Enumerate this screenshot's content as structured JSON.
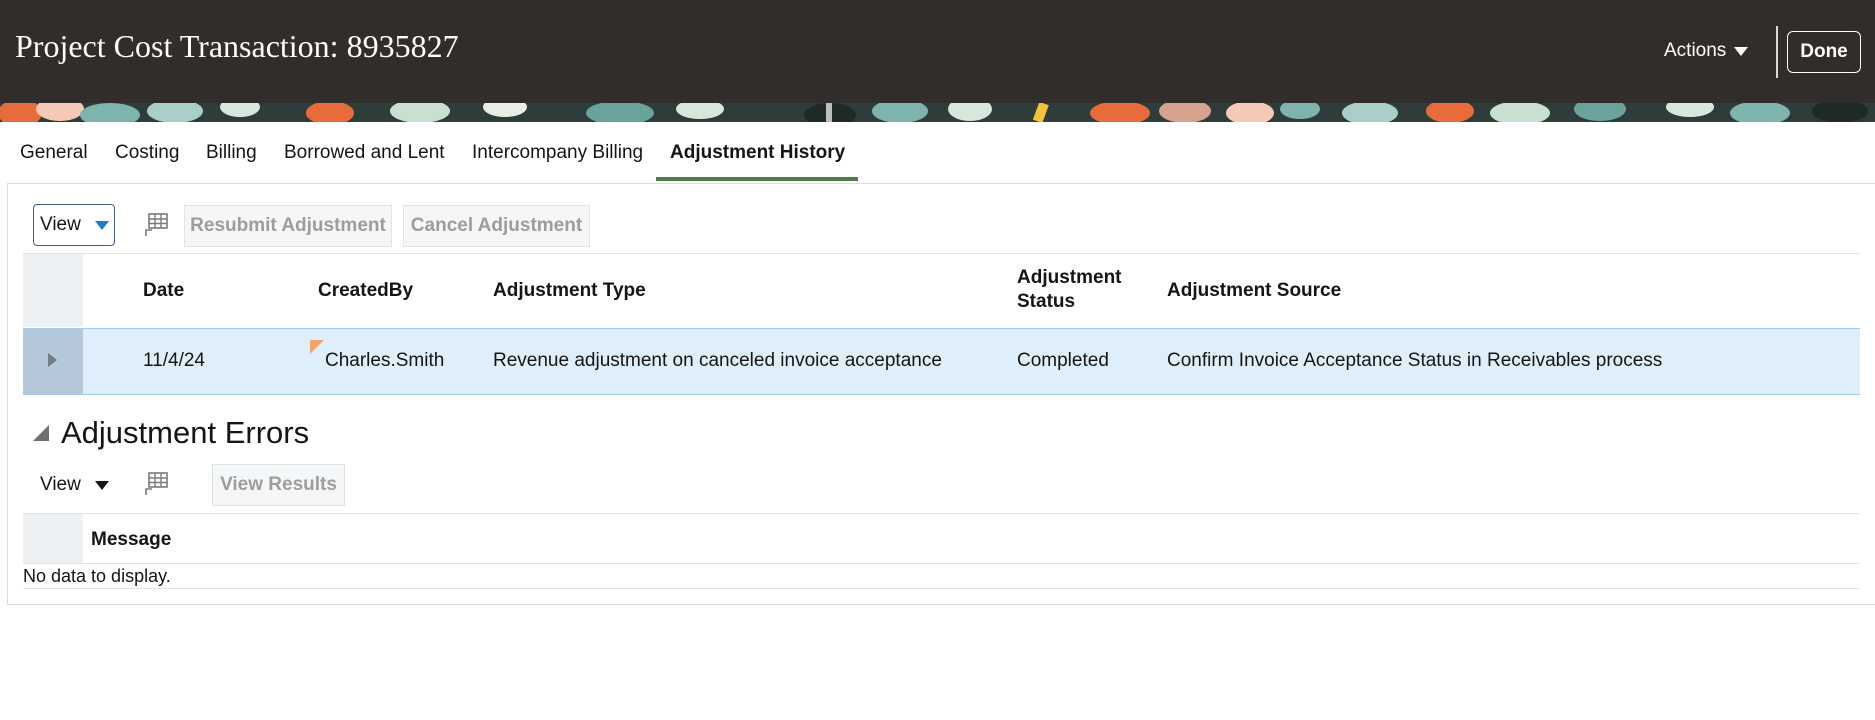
{
  "header": {
    "title": "Project Cost Transaction: 8935827",
    "actions_label": "Actions",
    "done_label": "Done",
    "background_color": "#312d2a"
  },
  "tabs": [
    {
      "label": "General"
    },
    {
      "label": "Costing"
    },
    {
      "label": "Billing"
    },
    {
      "label": "Borrowed and Lent"
    },
    {
      "label": "Intercompany Billing"
    },
    {
      "label": "Adjustment History",
      "active": true
    }
  ],
  "history": {
    "view_label": "View",
    "resubmit_label": "Resubmit Adjustment",
    "cancel_label": "Cancel Adjustment",
    "columns": {
      "date": "Date",
      "created_by": "CreatedBy",
      "adj_type": "Adjustment Type",
      "adj_status_1": "Adjustment",
      "adj_status_2": "Status",
      "adj_source": "Adjustment Source"
    },
    "rows": [
      {
        "date": "11/4/24",
        "created_by": "Charles.Smith",
        "adj_type": "Revenue adjustment on canceled invoice acceptance",
        "adj_status": "Completed",
        "adj_source": "Confirm Invoice Acceptance Status in Receivables process"
      }
    ]
  },
  "errors": {
    "title": "Adjustment Errors",
    "view_label": "View",
    "view_results_label": "View Results",
    "columns": {
      "message": "Message"
    },
    "empty_text": "No data to display."
  },
  "colors": {
    "accent_tab": "#4f7d49",
    "selected_row": "#dfeefb",
    "view_dropdown_arrow": "#227acc"
  }
}
